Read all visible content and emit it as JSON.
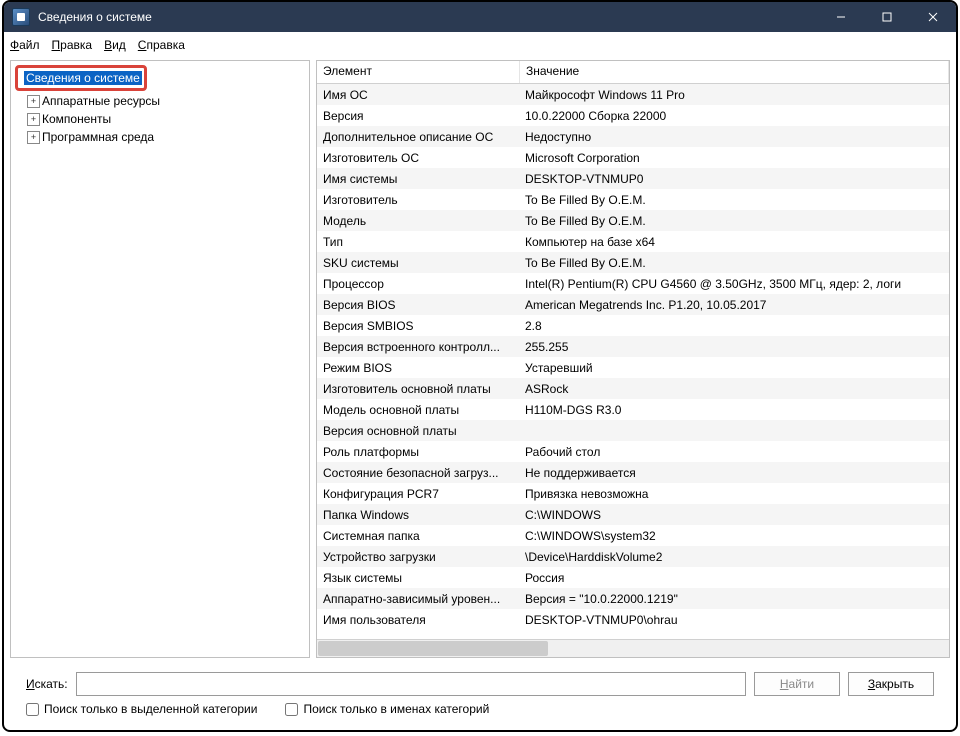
{
  "window": {
    "title": "Сведения о системе"
  },
  "menu": {
    "file": "Файл",
    "edit": "Правка",
    "view": "Вид",
    "help": "Справка",
    "file_u": "Ф",
    "edit_u": "П",
    "view_u": "В",
    "help_u": "С"
  },
  "tree": {
    "root": "Сведения о системе",
    "hardware": "Аппаратные ресурсы",
    "components": "Компоненты",
    "software": "Программная среда"
  },
  "table": {
    "header_element": "Элемент",
    "header_value": "Значение",
    "rows": [
      {
        "el": "Имя ОС",
        "val": "Майкрософт Windows 11 Pro"
      },
      {
        "el": "Версия",
        "val": "10.0.22000 Сборка 22000"
      },
      {
        "el": "Дополнительное описание ОС",
        "val": "Недоступно"
      },
      {
        "el": "Изготовитель ОС",
        "val": "Microsoft Corporation"
      },
      {
        "el": "Имя системы",
        "val": "DESKTOP-VTNMUP0"
      },
      {
        "el": "Изготовитель",
        "val": "To Be Filled By O.E.M."
      },
      {
        "el": "Модель",
        "val": "To Be Filled By O.E.M."
      },
      {
        "el": "Тип",
        "val": "Компьютер на базе x64"
      },
      {
        "el": "SKU системы",
        "val": "To Be Filled By O.E.M."
      },
      {
        "el": "Процессор",
        "val": "Intel(R) Pentium(R) CPU G4560 @ 3.50GHz, 3500 МГц, ядер: 2, логи"
      },
      {
        "el": "Версия BIOS",
        "val": "American Megatrends Inc. P1.20, 10.05.2017"
      },
      {
        "el": "Версия SMBIOS",
        "val": "2.8"
      },
      {
        "el": "Версия встроенного контролл...",
        "val": "255.255"
      },
      {
        "el": "Режим BIOS",
        "val": "Устаревший"
      },
      {
        "el": "Изготовитель основной платы",
        "val": "ASRock"
      },
      {
        "el": "Модель основной платы",
        "val": "H110M-DGS R3.0"
      },
      {
        "el": "Версия основной платы",
        "val": ""
      },
      {
        "el": "Роль платформы",
        "val": "Рабочий стол"
      },
      {
        "el": "Состояние безопасной загруз...",
        "val": "Не поддерживается"
      },
      {
        "el": "Конфигурация PCR7",
        "val": "Привязка невозможна"
      },
      {
        "el": "Папка Windows",
        "val": "C:\\WINDOWS"
      },
      {
        "el": "Системная папка",
        "val": "C:\\WINDOWS\\system32"
      },
      {
        "el": "Устройство загрузки",
        "val": "\\Device\\HarddiskVolume2"
      },
      {
        "el": "Язык системы",
        "val": "Россия"
      },
      {
        "el": "Аппаратно-зависимый уровен...",
        "val": "Версия = \"10.0.22000.1219\""
      },
      {
        "el": "Имя пользователя",
        "val": "DESKTOP-VTNMUP0\\ohrau"
      }
    ]
  },
  "search": {
    "label": "Искать:",
    "find": "Найти",
    "close": "Закрыть",
    "check1": "Поиск только в выделенной категории",
    "check2": "Поиск только в именах категорий"
  }
}
